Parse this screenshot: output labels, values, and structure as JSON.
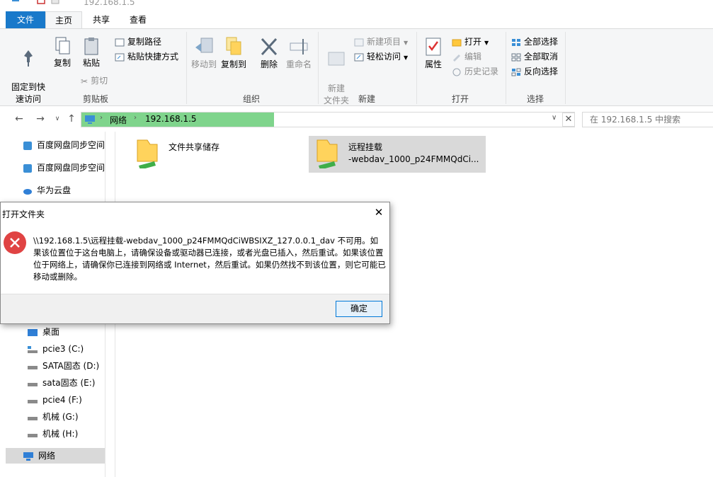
{
  "window": {
    "title": "192.168.1.5"
  },
  "tabs": [
    "文件",
    "主页",
    "共享",
    "查看"
  ],
  "ribbon": {
    "clipboard": {
      "pin": "固定到快\n速访问",
      "copy": "复制",
      "paste": "粘贴",
      "copy_path": "复制路径",
      "paste_shortcut": "粘贴快捷方式",
      "cut": "剪切",
      "group": "剪贴板"
    },
    "organize": {
      "move_to": "移动到",
      "copy_to": "复制到",
      "delete": "删除",
      "rename": "重命名",
      "group": "组织"
    },
    "new": {
      "new_folder": "新建\n文件夹",
      "new_item": "新建项目",
      "easy_access": "轻松访问",
      "group": "新建"
    },
    "open": {
      "properties": "属性",
      "open": "打开",
      "edit": "编辑",
      "history": "历史记录",
      "group": "打开"
    },
    "select": {
      "select_all": "全部选择",
      "select_none": "全部取消",
      "invert": "反向选择",
      "group": "选择"
    }
  },
  "address": {
    "crumbs": [
      "网络",
      "192.168.1.5"
    ],
    "search_placeholder": "在 192.168.1.5 中搜索"
  },
  "nav": {
    "top_items": [
      "百度网盘同步空间",
      "百度网盘同步空间",
      "华为云盘"
    ],
    "bottom_items": [
      "桌面",
      "pcie3 (C:)",
      "SATA固态 (D:)",
      "sata固态 (E:)",
      "pcie4 (F:)",
      "机械 (G:)",
      "机械 (H:)",
      "网络"
    ]
  },
  "content": {
    "items": [
      {
        "name": "文件共享储存"
      },
      {
        "name": "远程挂载\n-webdav_1000_p24FMMQdCi..."
      }
    ]
  },
  "dialog": {
    "title": "打开文件夹",
    "message": "\\\\192.168.1.5\\远程挂载-webdav_1000_p24FMMQdCiWBSIXZ_127.0.0.1_dav 不可用。如果该位置位于这台电脑上，请确保设备或驱动器已连接，或者光盘已插入，然后重试。如果该位置位于网络上，请确保你已连接到网络或 Internet，然后重试。如果仍然找不到该位置，则它可能已移动或删除。",
    "ok": "确定"
  },
  "colors": {
    "accent": "#1979ca",
    "progress": "#7fd48c",
    "error": "#e04343"
  }
}
